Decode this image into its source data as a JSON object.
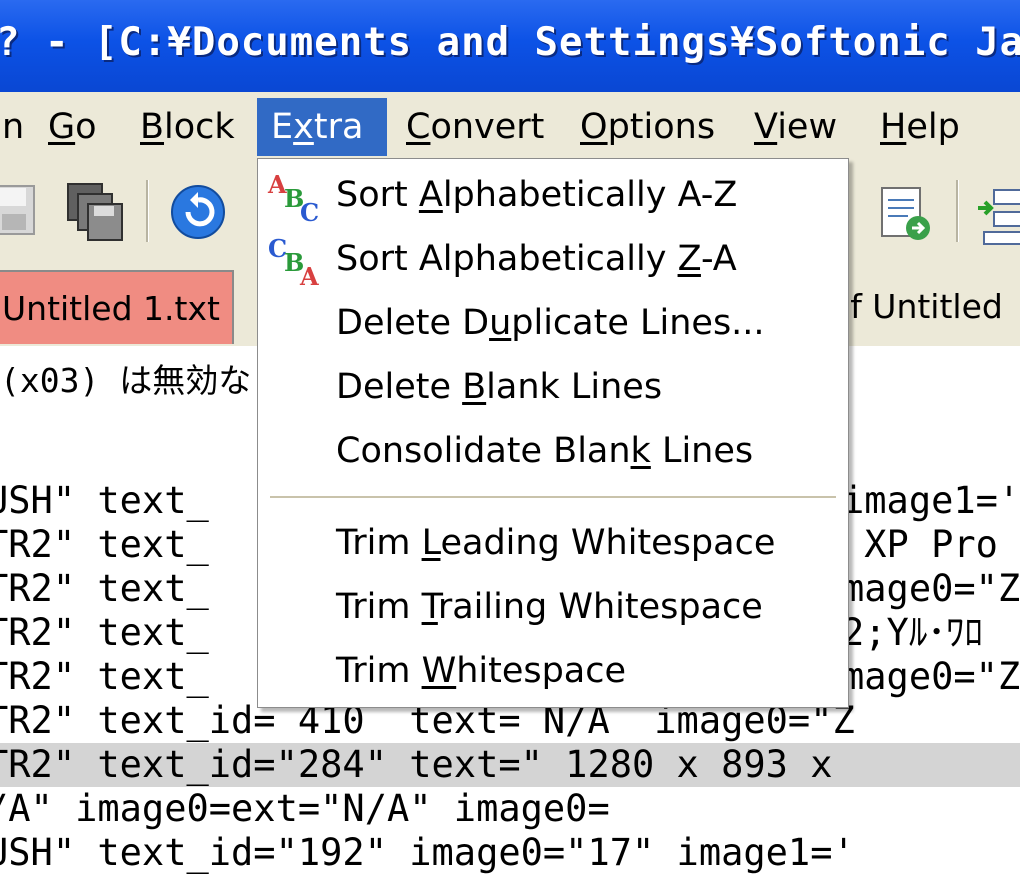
{
  "window": {
    "title": "? - [C:¥Documents and Settings¥Softonic Japa"
  },
  "menubar": {
    "items": [
      {
        "label": "n",
        "mnemonic": ""
      },
      {
        "label": "Go",
        "mnemonic": "G"
      },
      {
        "label": "Block",
        "mnemonic": "B"
      },
      {
        "label": "Extra",
        "mnemonic": "x"
      },
      {
        "label": "Convert",
        "mnemonic": "C"
      },
      {
        "label": "Options",
        "mnemonic": "O"
      },
      {
        "label": "View",
        "mnemonic": "V"
      },
      {
        "label": "Help",
        "mnemonic": "H"
      }
    ],
    "active_item": "Extra"
  },
  "tabs": [
    {
      "label": "Untitled 1.txt",
      "active": true
    },
    {
      "label": "of Untitled",
      "active": false
    }
  ],
  "editor": {
    "message_line": "(x03) は無効な",
    "lines": [
      "USH\" text_",
      "TR2\" text_",
      "TR2\" text_",
      "TR2\" text_",
      "TR2\" text_",
      "TR2\" text_id= 410  text= N/A  image0=\"Z",
      "TR2\" text_id=\"284\" text=\" 1280 x 893 x",
      "/A\" image0=ext=\"N/A\" image0=",
      "USH\" text_id=\"192\" image0=\"17\" image1='"
    ],
    "right_fragments": [
      "image1='",
      " XP Pro",
      "mage0=\"Z",
      "2;Yﾙ･ﾜﾛ",
      "mage0=\"Z"
    ],
    "highlighted_line_index": 6
  },
  "dropdown": {
    "items": [
      {
        "pre": "Sort ",
        "u": "A",
        "post": "lphabetically A-Z",
        "icon": "sort-az-icon"
      },
      {
        "pre": "Sort Alphabetically ",
        "u": "Z",
        "post": "-A",
        "icon": "sort-za-icon"
      },
      {
        "pre": "Delete D",
        "u": "u",
        "post": "plicate Lines...",
        "icon": ""
      },
      {
        "pre": "Delete ",
        "u": "B",
        "post": "lank Lines",
        "icon": ""
      },
      {
        "pre": "Consolidate Blan",
        "u": "k",
        "post": " Lines",
        "icon": ""
      },
      {
        "pre": "Trim ",
        "u": "L",
        "post": "eading Whitespace",
        "icon": ""
      },
      {
        "pre": "Trim ",
        "u": "T",
        "post": "railing Whitespace",
        "icon": ""
      },
      {
        "pre": "Trim ",
        "u": "W",
        "post": "hitespace",
        "icon": ""
      }
    ]
  },
  "colors": {
    "titlebar": "#0c52e6",
    "menu_highlight": "#316ac5",
    "active_tab": "#f08c82",
    "chrome": "#ece9d8"
  }
}
